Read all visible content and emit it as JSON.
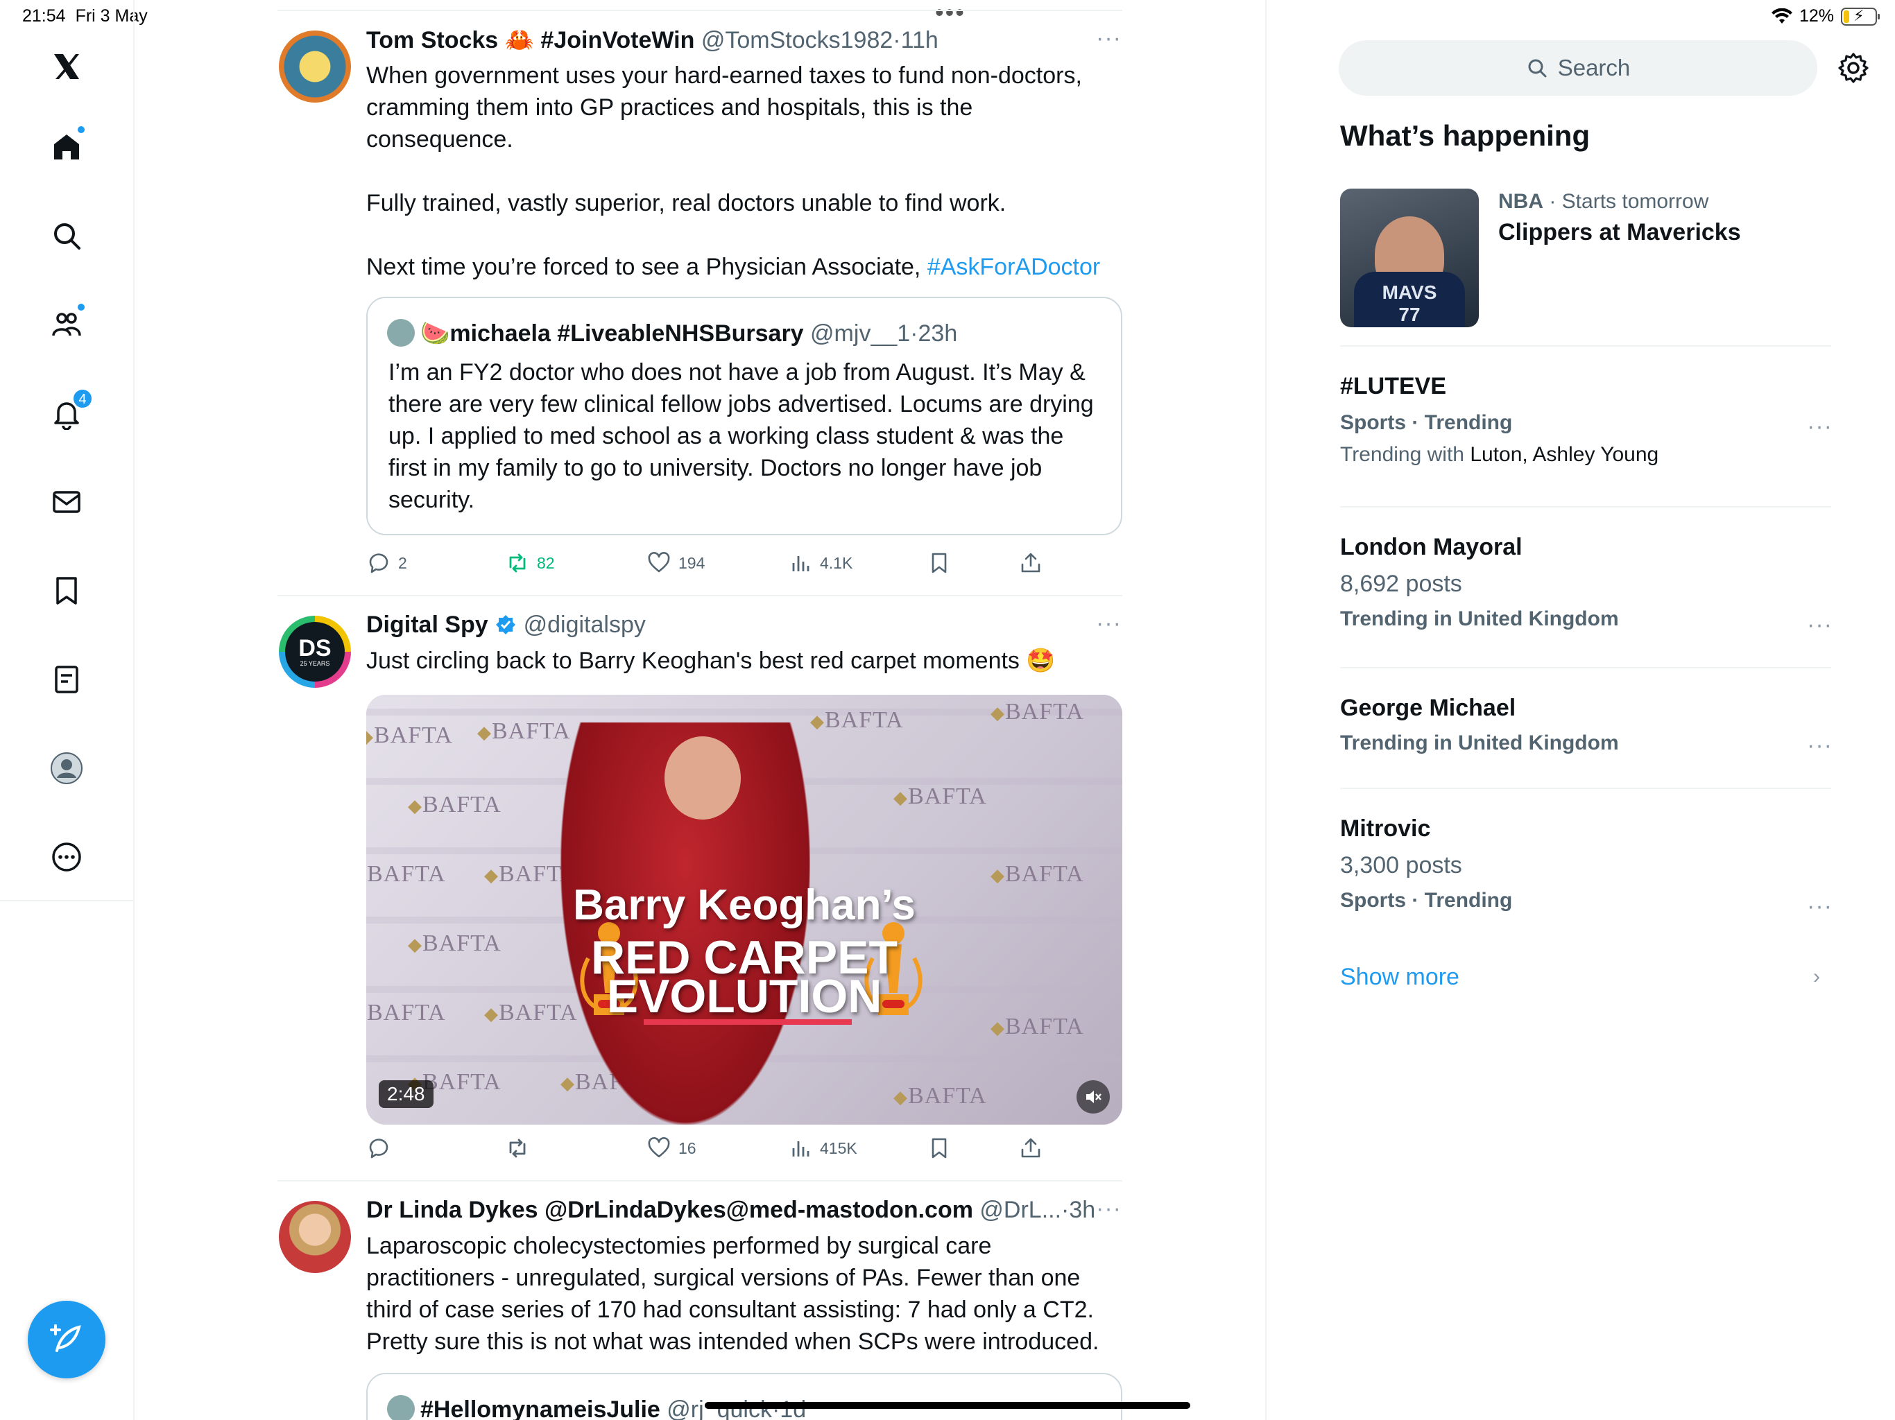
{
  "status": {
    "time": "21:54",
    "date": "Fri 3 May",
    "battery": "12%"
  },
  "nav": {
    "notifications_badge": "4"
  },
  "posts": [
    {
      "name": "Tom Stocks 🦀 #JoinVoteWin",
      "handle": "@TomStocks1982",
      "time": "11h",
      "text1": "When government uses your hard-earned taxes to fund non-doctors, cramming them into GP practices and hospitals, this is the consequence.",
      "text2": "Fully trained, vastly superior, real doctors unable to find work.",
      "text3": "Next time you’re forced to see a Physician Associate, ",
      "hashtag": "#AskForADoctor",
      "quote": {
        "name": "🍉michaela #LiveableNHSBursary",
        "handle": "@mjv__1",
        "time": "23h",
        "text": "I’m an FY2 doctor who does not have a job from August. It’s May & there are very few clinical fellow jobs advertised. Locums are drying up. I applied to med school as a working class student & was the first in my family to go to university. Doctors no longer have job security."
      },
      "replies": "2",
      "reposts": "82",
      "likes": "194",
      "views": "4.1K"
    },
    {
      "name": "Digital Spy",
      "handle": "@digitalspy",
      "avatar_text": "DS",
      "avatar_sub": "25 YEARS",
      "text": "Just circling back to Barry Keoghan's best red carpet moments 🤩",
      "video": {
        "title1": "Barry Keoghan’s",
        "title2": "RED CARPET",
        "title3": "EVOLUTION",
        "duration": "2:48",
        "backdrop_word": "BAFTA"
      },
      "replies": "",
      "reposts": "",
      "likes": "16",
      "views": "415K"
    },
    {
      "name": "Dr Linda Dykes @DrLindaDykes@med-mastodon.com",
      "handle": "@DrL...",
      "time": "3h",
      "text": "Laparoscopic cholecystectomies performed by surgical care practitioners - unregulated, surgical versions of PAs. Fewer than one third of case series of 170 had consultant assisting: 7 had only a CT2. Pretty sure this is not what was intended when SCPs were introduced.",
      "quote": {
        "name": "#HellomynameisJulie",
        "handle": "@rj_quick",
        "time": "1d"
      }
    }
  ],
  "sidebar": {
    "search_placeholder": "Search",
    "title": "What’s happening",
    "event": {
      "category": "NBA",
      "when": "Starts tomorrow",
      "name": "Clippers at Mavericks",
      "jersey": "MAVS",
      "number": "77"
    },
    "trends": [
      {
        "name": "#LUTEVE",
        "meta": "Sports · Trending",
        "context_prefix": "Trending with ",
        "context": "Luton, Ashley Young"
      },
      {
        "name": "London Mayoral",
        "count": "8,692 posts",
        "meta": "Trending in United Kingdom"
      },
      {
        "name": "George Michael",
        "meta": "Trending in United Kingdom"
      },
      {
        "name": "Mitrovic",
        "count": "3,300 posts",
        "meta": "Sports · Trending"
      }
    ],
    "show_more": "Show more"
  },
  "colors": {
    "accent": "#1d9bf0",
    "repost": "#00ba7c",
    "muted": "#536471"
  }
}
